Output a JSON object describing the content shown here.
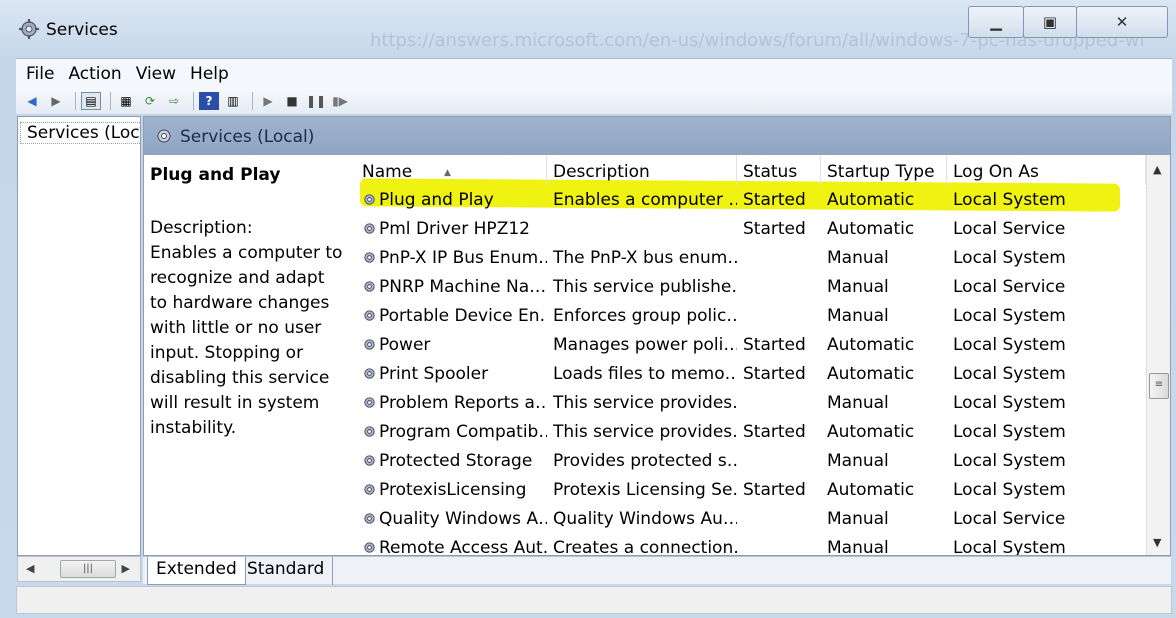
{
  "window": {
    "title": "Services",
    "ghost_url": "https://answers.microsoft.com/en-us/windows/forum/all/windows-7-pc-has-dropped-wi"
  },
  "menu": [
    "File",
    "Action",
    "View",
    "Help"
  ],
  "tree": {
    "item": "Services (Local)"
  },
  "content": {
    "header": "Services (Local)",
    "selected": {
      "name": "Plug and Play",
      "desc_label": "Description:",
      "desc_text": "Enables a computer to recognize and adapt to hardware changes with little or no user input. Stopping or disabling this service will result in system instability."
    }
  },
  "table": {
    "columns": [
      "Name",
      "Description",
      "Status",
      "Startup Type",
      "Log On As"
    ],
    "rows": [
      [
        "Plug and Play",
        "Enables a computer …",
        "Started",
        "Automatic",
        "Local System"
      ],
      [
        "Pml Driver HPZ12",
        "",
        "Started",
        "Automatic",
        "Local Service"
      ],
      [
        "PnP-X IP Bus Enum…",
        "The PnP-X bus enum…",
        "",
        "Manual",
        "Local System"
      ],
      [
        "PNRP Machine Na…",
        "This service publishe…",
        "",
        "Manual",
        "Local Service"
      ],
      [
        "Portable Device En…",
        "Enforces group polic…",
        "",
        "Manual",
        "Local System"
      ],
      [
        "Power",
        "Manages power poli…",
        "Started",
        "Automatic",
        "Local System"
      ],
      [
        "Print Spooler",
        "Loads files to memo…",
        "Started",
        "Automatic",
        "Local System"
      ],
      [
        "Problem Reports a…",
        "This service provides…",
        "",
        "Manual",
        "Local System"
      ],
      [
        "Program Compatib…",
        "This service provides…",
        "Started",
        "Automatic",
        "Local System"
      ],
      [
        "Protected Storage",
        "Provides protected s…",
        "",
        "Manual",
        "Local System"
      ],
      [
        "ProtexisLicensing",
        "Protexis Licensing Se…",
        "Started",
        "Automatic",
        "Local System"
      ],
      [
        "Quality Windows A…",
        "Quality Windows Au…",
        "",
        "Manual",
        "Local Service"
      ],
      [
        "Remote Access Aut…",
        "Creates a connection…",
        "",
        "Manual",
        "Local System"
      ]
    ]
  },
  "tabs": [
    "Extended",
    "Standard"
  ],
  "colors": {
    "highlight": "#f0f212",
    "header_band": "#9fb3cc"
  }
}
